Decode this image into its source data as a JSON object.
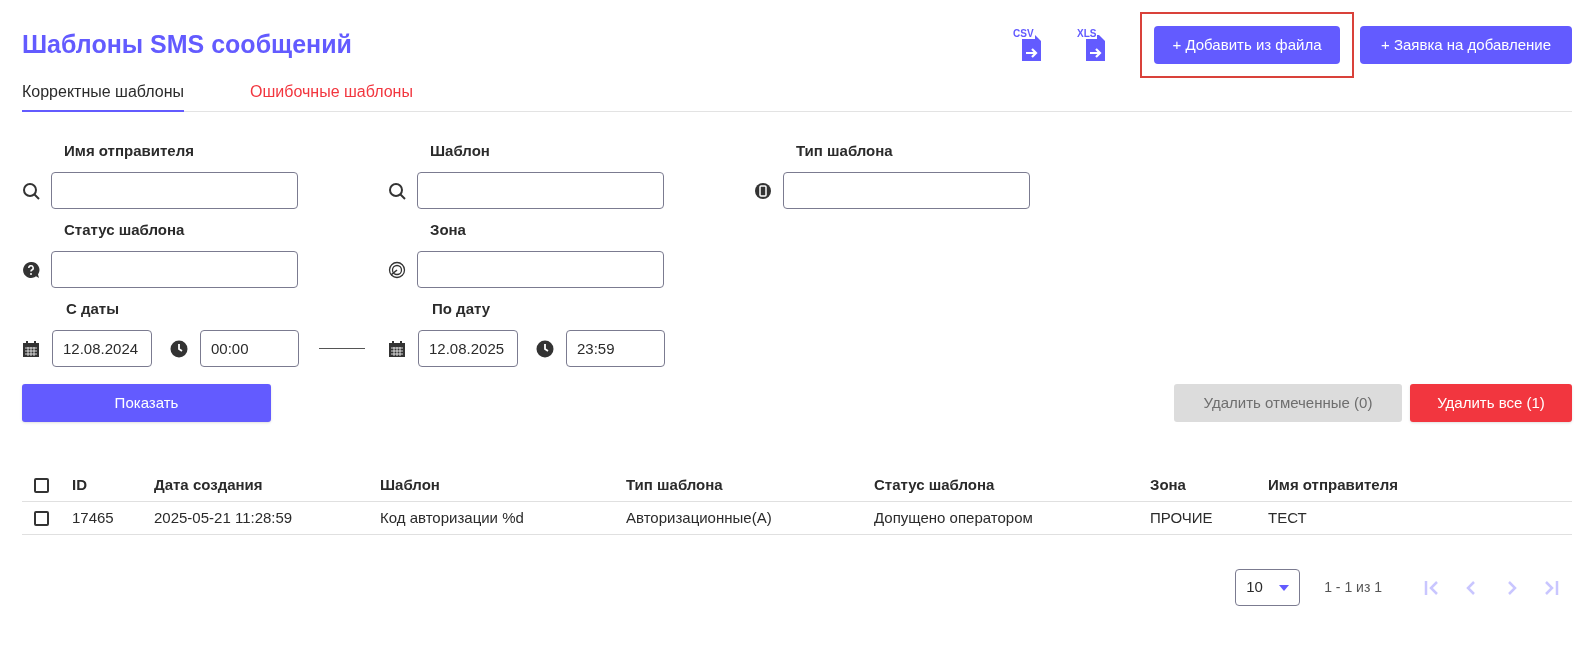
{
  "title": "Шаблоны SMS сообщений",
  "exports": [
    {
      "label": "CSV"
    },
    {
      "label": "XLS"
    }
  ],
  "header_buttons": [
    {
      "label": "+ Добавить из файла",
      "highlighted": true
    },
    {
      "label": "+ Заявка на добавление",
      "highlighted": false
    }
  ],
  "tabs": [
    {
      "label": "Корректные шаблоны",
      "selected": true,
      "color": "#2b2b2b"
    },
    {
      "label": "Ошибочные шаблоны",
      "selected": false,
      "color": "#f2363f"
    }
  ],
  "filter_rows": [
    {
      "kind": "text",
      "fields": [
        {
          "label": "Имя отправителя",
          "kind": "search"
        },
        {
          "label": "Шаблон",
          "kind": "search"
        },
        {
          "label": "Тип шаблона",
          "kind": "phone"
        }
      ]
    },
    {
      "kind": "text",
      "fields": [
        {
          "label": "Статус шаблона",
          "kind": "status"
        },
        {
          "label": "Зона",
          "kind": "zone"
        }
      ]
    },
    {
      "kind": "range",
      "fields": [
        {
          "label": "С даты",
          "date": "12.08.2024",
          "time": "00:00"
        },
        {
          "label": "По дату",
          "date": "12.08.2025",
          "time": "23:59"
        }
      ]
    }
  ],
  "show_button": "Показать",
  "delete_buttons": [
    {
      "label": "Удалить отмеченные (0)",
      "disabled": true
    },
    {
      "label": "Удалить все (1)",
      "disabled": false
    }
  ],
  "table": {
    "header_checked": false,
    "columns": [
      "ID",
      "Дата создания",
      "Шаблон",
      "Тип шаблона",
      "Статус шаблона",
      "Зона",
      "Имя отправителя"
    ],
    "rows": [
      {
        "checked": false,
        "cells": [
          "17465",
          "2025-05-21 11:28:59",
          "Код авторизации %d",
          "Авторизационные(А)",
          "Допущено оператором",
          "ПРОЧИЕ",
          "ТЕСТ"
        ]
      }
    ]
  },
  "pagination": {
    "page_size": "10",
    "range": "1 - 1 из 1"
  }
}
